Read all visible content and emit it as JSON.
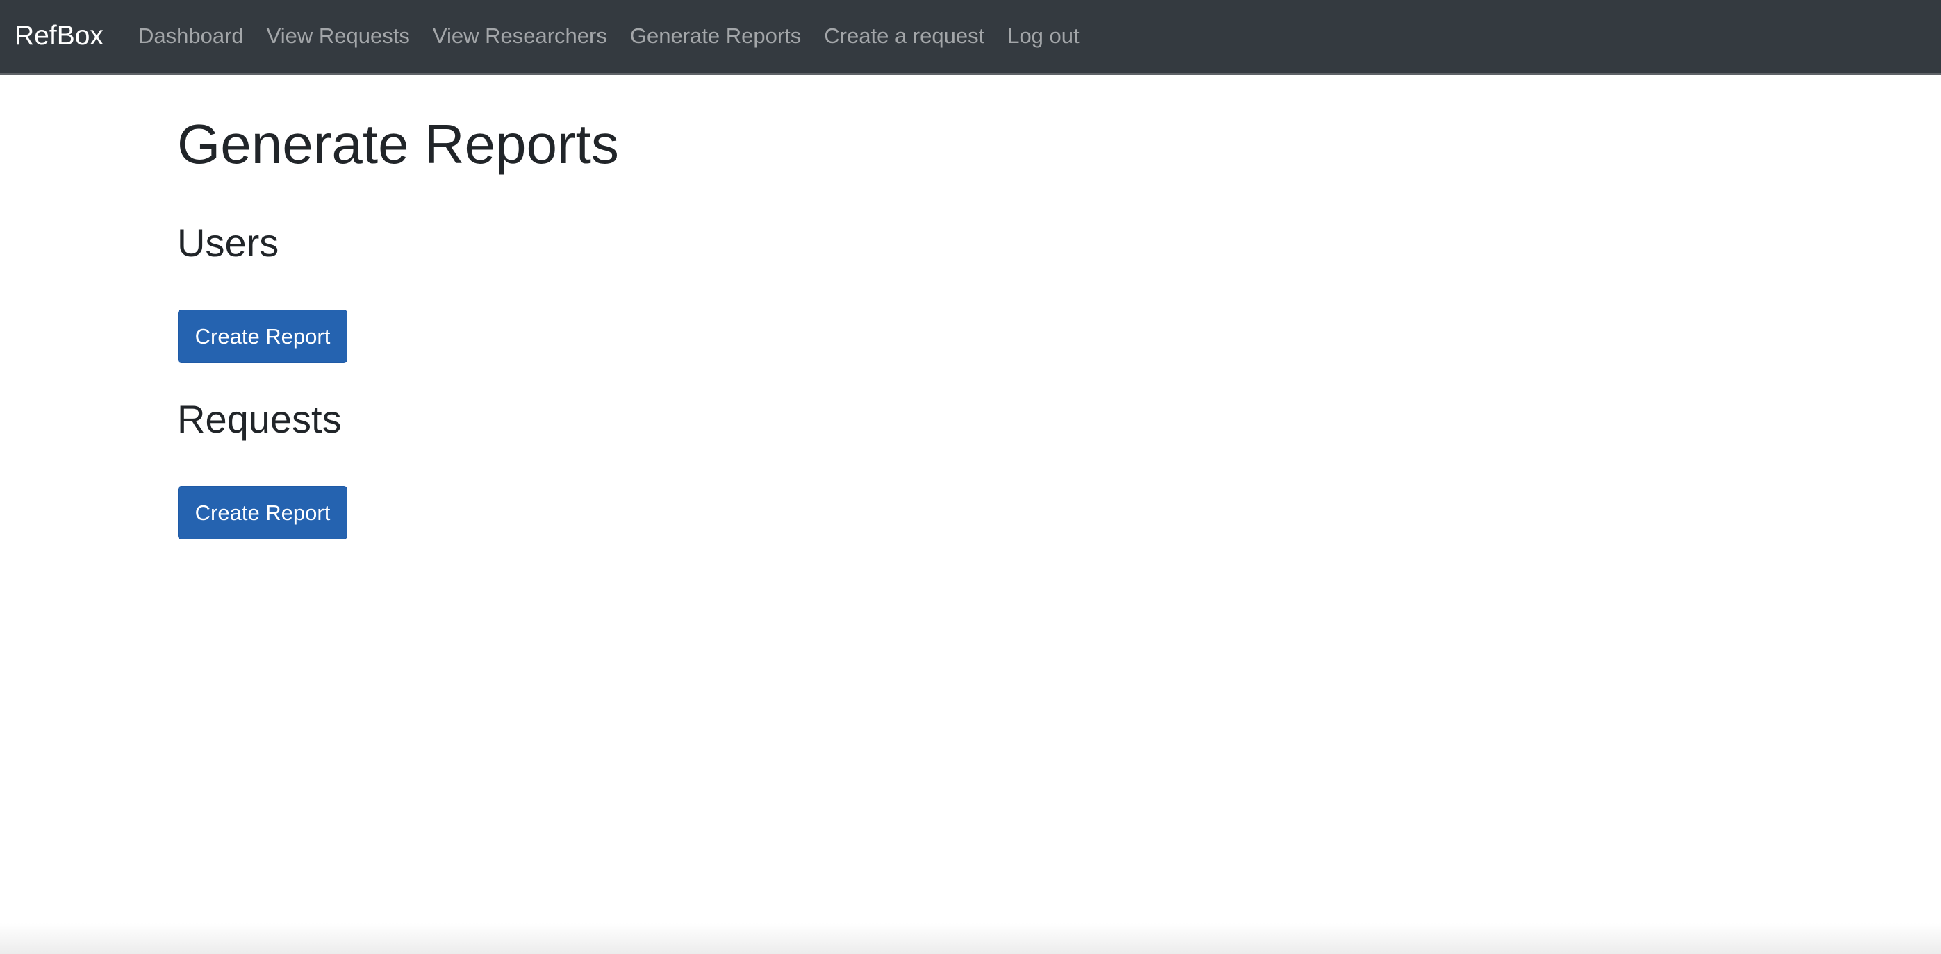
{
  "navbar": {
    "brand": "RefBox",
    "links": [
      {
        "label": "Dashboard"
      },
      {
        "label": "View Requests"
      },
      {
        "label": "View Researchers"
      },
      {
        "label": "Generate Reports"
      },
      {
        "label": "Create a request"
      },
      {
        "label": "Log out"
      }
    ]
  },
  "main": {
    "title": "Generate Reports",
    "sections": [
      {
        "heading": "Users",
        "button_label": "Create Report"
      },
      {
        "heading": "Requests",
        "button_label": "Create Report"
      }
    ]
  },
  "colors": {
    "navbar_bg": "#343a40",
    "primary_button": "#2563b0",
    "text": "#212529"
  }
}
